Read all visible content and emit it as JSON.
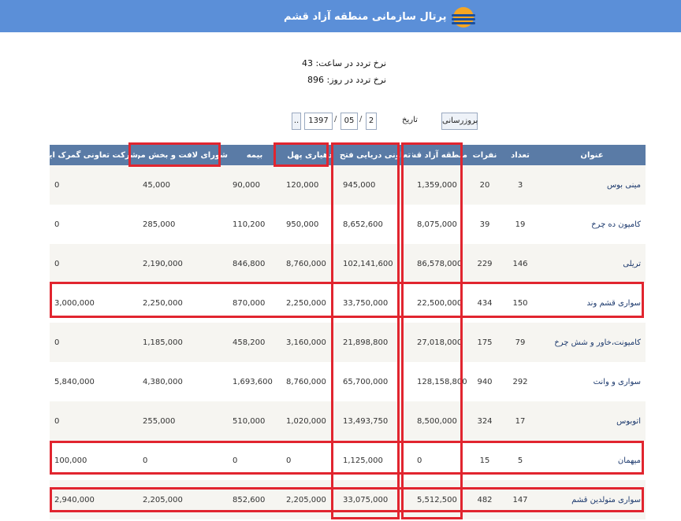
{
  "header": {
    "portal_title": "پرتال سازمانی منطقه آزاد قشم",
    "logo_icon": "sun-wave-logo-icon"
  },
  "stats": {
    "hourly": "نرخ تردد در ساعت: 43",
    "daily": "نرخ تردد در روز: 896"
  },
  "date_form": {
    "refresh_label": "بروزرسانی",
    "date_label": "تاریخ",
    "day": "2",
    "month": "05",
    "year": "1397",
    "picker_label": "..",
    "separator": "/"
  },
  "table": {
    "columns": [
      "عنوان",
      "تعداد",
      "نفرات",
      "منطقه آزاد قشم",
      "تعاونی دریایی فتح",
      "دهیاری پهل",
      "بیمه",
      "شورای لافت و بخش مرکزی",
      "شرکت تعاونی گمرک ایران"
    ],
    "rows": [
      [
        "مینی بوس",
        "3",
        "20",
        "1,359,000",
        "945,000",
        "120,000",
        "90,000",
        "45,000",
        "0"
      ],
      [
        "کامیون ده چرخ",
        "19",
        "39",
        "8,075,000",
        "8,652,600",
        "950,000",
        "110,200",
        "285,000",
        "0"
      ],
      [
        "تریلی",
        "146",
        "229",
        "86,578,000",
        "102,141,600",
        "8,760,000",
        "846,800",
        "2,190,000",
        "0"
      ],
      [
        "سواری قشم وند",
        "150",
        "434",
        "22,500,000",
        "33,750,000",
        "2,250,000",
        "870,000",
        "2,250,000",
        "3,000,000"
      ],
      [
        "کامیونت،خاور و شش چرخ",
        "79",
        "175",
        "27,018,000",
        "21,898,800",
        "3,160,000",
        "458,200",
        "1,185,000",
        "0"
      ],
      [
        "سواری و وانت",
        "292",
        "940",
        "128,158,800",
        "65,700,000",
        "8,760,000",
        "1,693,600",
        "4,380,000",
        "5,840,000"
      ],
      [
        "اتوبوس",
        "17",
        "324",
        "8,500,000",
        "13,493,750",
        "1,020,000",
        "510,000",
        "255,000",
        "0"
      ],
      [
        "میهمان",
        "5",
        "15",
        "0",
        "1,125,000",
        "0",
        "0",
        "0",
        "100,000"
      ],
      [
        "سواری متولدین قشم",
        "147",
        "482",
        "5,512,500",
        "33,075,000",
        "2,205,000",
        "852,600",
        "2,205,000",
        "2,940,000"
      ]
    ]
  },
  "highlight_color": "#e1252f",
  "header_color": "#5b8fd8",
  "table_header_color": "#5a7ba6"
}
